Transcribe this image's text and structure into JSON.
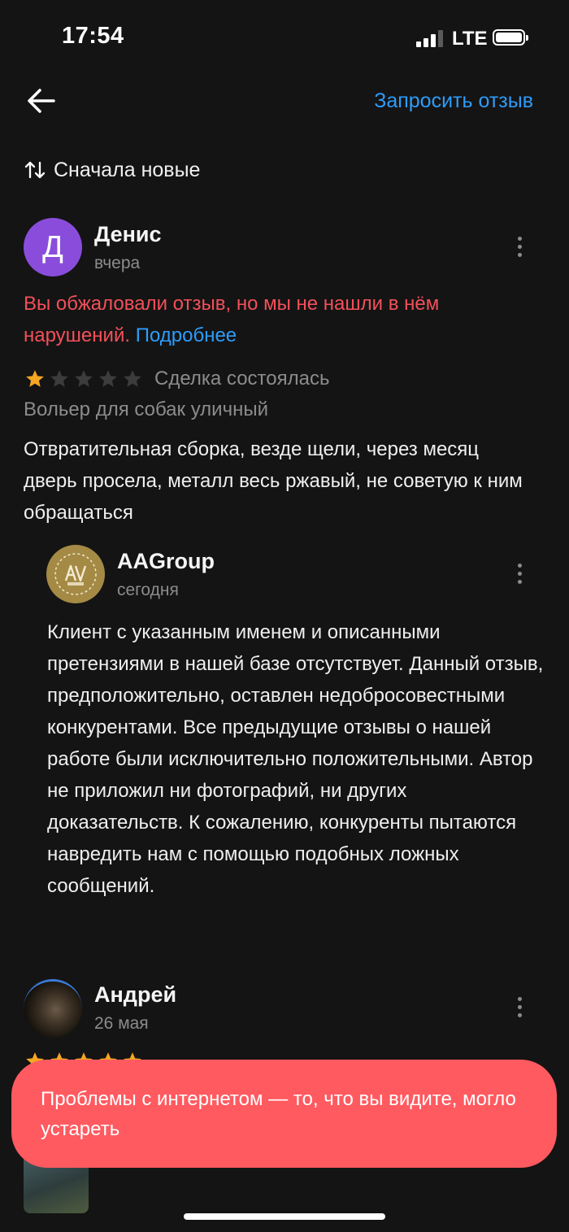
{
  "status_bar": {
    "time": "17:54",
    "network": "LTE"
  },
  "header": {
    "request_review": "Запросить отзыв"
  },
  "sort": {
    "label": "Сначала новые"
  },
  "reviews": [
    {
      "avatar_letter": "Д",
      "author": "Денис",
      "date": "вчера",
      "appeal_notice": "Вы обжаловали отзыв, но мы не нашли в нём нарушений.",
      "appeal_link": "Подробнее",
      "rating": 1,
      "deal_status": "Сделка состоялась",
      "product": "Вольер для собак уличный",
      "text": "Отвратительная сборка, везде щели, через месяц дверь просела, металл весь ржавый, не советую к ним обращаться",
      "reply": {
        "author": "AAGroup",
        "date": "сегодня",
        "text": "Клиент с указанным именем и описанными претензиями в нашей базе отсутствует. Данный отзыв, предположительно, оставлен недобросовестными конкурентами. Все предыдущие отзывы о нашей работе были исключительно положительными. Автор не приложил ни фотографий, ни других доказательств. К сожалению, конкуренты пытаются навредить нам с помощью подобных ложных сообщений."
      }
    },
    {
      "author": "Андрей",
      "date": "26 мая",
      "rating": 5
    }
  ],
  "toast": {
    "message": "Проблемы с интернетом — то, что вы видите, могло устареть"
  },
  "colors": {
    "background": "#141414",
    "accent": "#2d9cfa",
    "warning": "#f2505a",
    "toast": "#ff5a60",
    "star": "#f5a623",
    "star_empty": "#3c3c3c",
    "avatar_d": "#8a4ddb"
  }
}
